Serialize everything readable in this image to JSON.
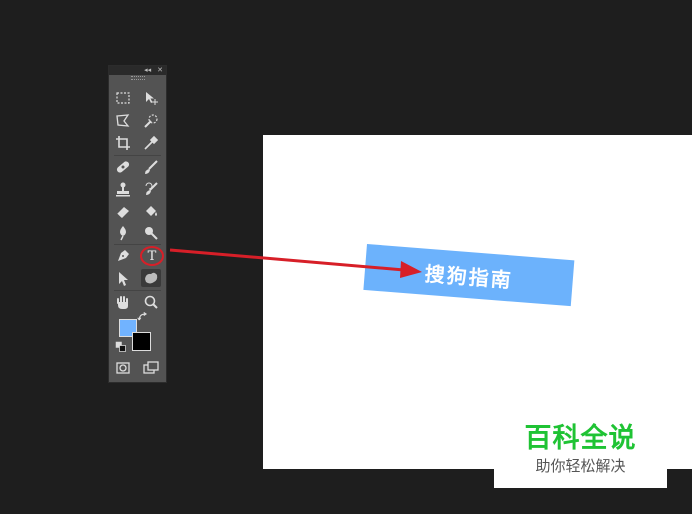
{
  "toolbar": {
    "collapse_glyph": "◂◂",
    "close_glyph": "✕",
    "tools": [
      {
        "name": "rectangular-marquee-tool-icon"
      },
      {
        "name": "move-tool-icon"
      },
      {
        "name": "polygonal-lasso-tool-icon"
      },
      {
        "name": "quick-selection-tool-icon"
      },
      {
        "name": "crop-tool-icon"
      },
      {
        "name": "eyedropper-tool-icon"
      },
      {
        "name": "spot-healing-brush-tool-icon"
      },
      {
        "name": "brush-tool-icon"
      },
      {
        "name": "clone-stamp-tool-icon"
      },
      {
        "name": "history-brush-tool-icon"
      },
      {
        "name": "eraser-tool-icon"
      },
      {
        "name": "paint-bucket-tool-icon"
      },
      {
        "name": "blur-tool-icon"
      },
      {
        "name": "dodge-tool-icon"
      },
      {
        "name": "pen-tool-icon"
      },
      {
        "name": "type-tool-icon"
      },
      {
        "name": "path-selection-tool-icon"
      },
      {
        "name": "custom-shape-tool-icon"
      },
      {
        "name": "hand-tool-icon"
      },
      {
        "name": "zoom-tool-icon"
      },
      {
        "name": "quick-mask-icon"
      },
      {
        "name": "screen-mode-icon"
      }
    ],
    "type_tool_glyph": "T",
    "type_tool_highlight": "#d71f28",
    "foreground_color": "#71b3ff",
    "background_color": "#000000"
  },
  "canvas": {
    "label_text": "搜狗指南",
    "label_color": "#6cb2fc"
  },
  "annotation_arrow_color": "#d71f28",
  "watermark": {
    "main": "百科全说",
    "sub": "助你轻松解决",
    "main_color": "#1fc334"
  }
}
